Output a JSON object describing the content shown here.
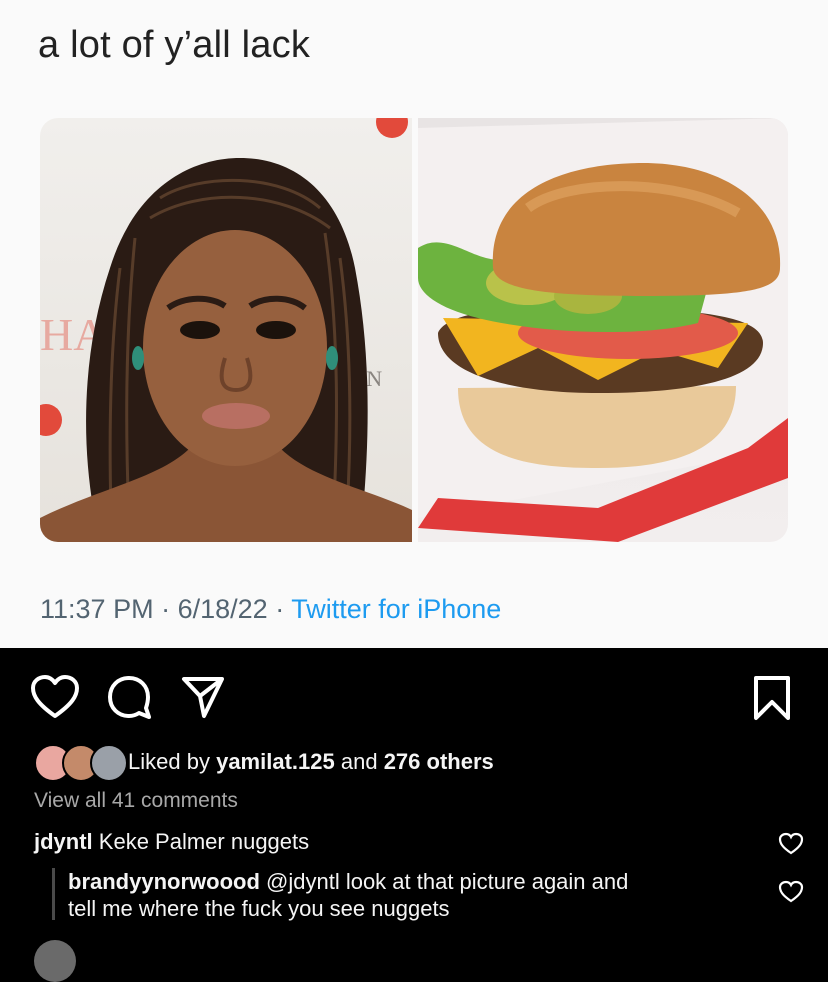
{
  "tweet": {
    "text": "a lot of y’all lack",
    "time": "11:37 PM",
    "date": "6/18/22",
    "app": "Twitter for iPhone",
    "sep": "·"
  },
  "instagram": {
    "likes_prefix": "Liked by",
    "likes_user": "yamilat.125",
    "likes_and": "and",
    "likes_others": "276 others",
    "view_all": "View all 41 comments",
    "comments": [
      {
        "user": "jdyntl",
        "text": "Keke Palmer nuggets"
      },
      {
        "user": "brandyynorwoood",
        "text": "@jdyntl look at that picture again and",
        "text2": "tell me where the fuck you see nuggets"
      }
    ]
  }
}
